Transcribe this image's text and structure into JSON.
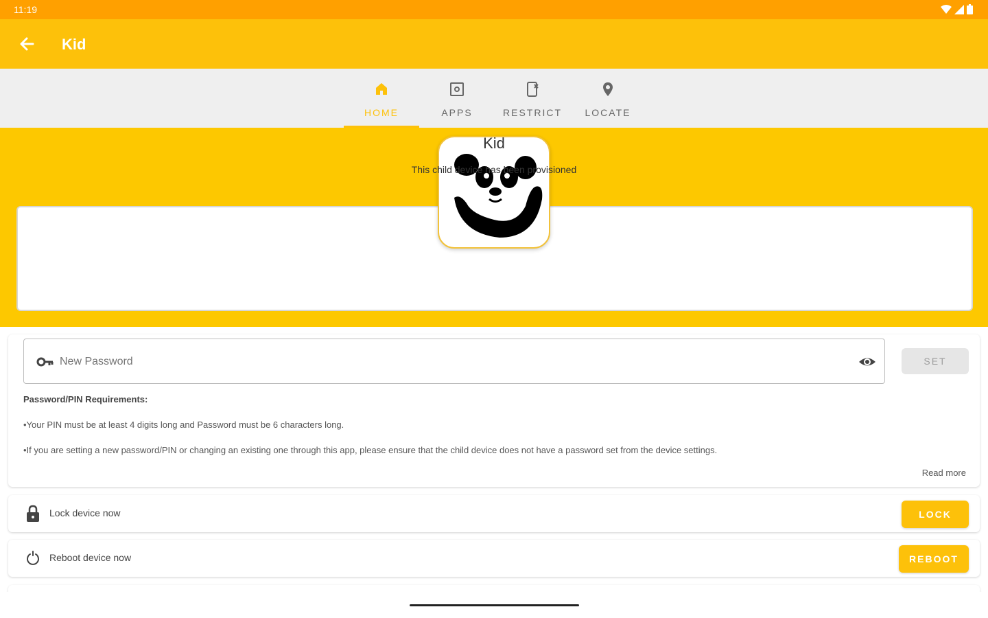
{
  "status_bar": {
    "time": "11:19",
    "icons": [
      "wifi-icon",
      "signal-icon",
      "battery-icon"
    ]
  },
  "app_bar": {
    "title": "Kid",
    "back_icon": "arrow-left-icon"
  },
  "tabs": [
    {
      "label": "HOME",
      "icon": "home-icon",
      "active": true
    },
    {
      "label": "APPS",
      "icon": "apps-icon",
      "active": false
    },
    {
      "label": "RESTRICT",
      "icon": "restrict-icon",
      "active": false
    },
    {
      "label": "LOCATE",
      "icon": "location-pin-icon",
      "active": false
    }
  ],
  "profile": {
    "avatar_icon": "panda-icon",
    "name": "Kid",
    "status": "This child device has been provisioned"
  },
  "password": {
    "placeholder": "New Password",
    "value": "",
    "set_label": "SET",
    "requirements_title": "Password/PIN Requirements:",
    "requirements": [
      "•Your PIN must be at least 4 digits long and Password must be 6 characters long.",
      "•If you are setting a new password/PIN or changing an existing one through this app, please ensure that the child device does not have a password set from the device settings."
    ],
    "read_more": "Read more"
  },
  "lock": {
    "label": "Lock device now",
    "button": "LOCK",
    "icon": "lock-icon"
  },
  "reboot": {
    "label": "Reboot device now",
    "button": "REBOOT",
    "icon": "power-icon"
  },
  "colors": {
    "status_bar": "#ffa000",
    "primary": "#fdc10a",
    "header_band": "#fdc800",
    "tab_bar": "#efefef"
  }
}
